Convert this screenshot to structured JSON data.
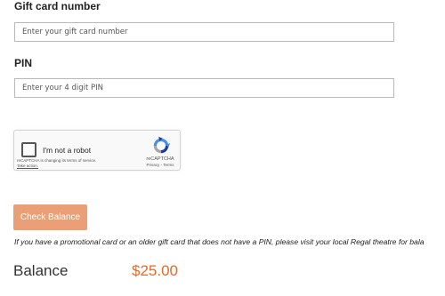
{
  "gift_card": {
    "label": "Gift card number",
    "placeholder": "Enter your gift card number",
    "value": ""
  },
  "pin": {
    "label": "PIN",
    "placeholder": "Enter your 4 digit PIN",
    "value": ""
  },
  "recaptcha": {
    "checkbox_label": "I'm not a robot",
    "checked": false,
    "notice": "reCAPTCHA is changing its terms of service.",
    "take_action": "Take action.",
    "brand": "reCAPTCHA",
    "terms": "Privacy - Terms",
    "icon": "recaptcha-logo"
  },
  "actions": {
    "check_balance_label": "Check Balance"
  },
  "promo_note": "If you have a promotional card or an older gift card that does not have a PIN, please visit your local Regal theatre for bala",
  "balance": {
    "label": "Balance",
    "amount": "$25.00"
  },
  "colors": {
    "button": "#eb9f76",
    "amount": "#e06b2b"
  }
}
